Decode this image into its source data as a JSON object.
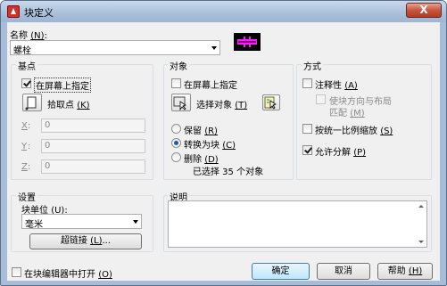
{
  "window": {
    "title": "块定义",
    "close_label": "X"
  },
  "name": {
    "label_text": "名称 ",
    "label_key": "(N)",
    "label_colon": ":",
    "value": "螺栓"
  },
  "base_point": {
    "group_label": "基点",
    "specify_on_screen_text": "在屏幕上指定",
    "pick_point_text": "拾取点 ",
    "pick_point_key": "(K)",
    "x_label": "X",
    "y_label": "Y",
    "z_label": "Z",
    "x_value": "0",
    "y_value": "0",
    "z_value": "0"
  },
  "objects": {
    "group_label": "对象",
    "specify_on_screen_text": "在屏幕上指定",
    "select_objects_text": "选择对象 ",
    "select_objects_key": "(T)",
    "retain_text": "保留 ",
    "retain_key": "(R)",
    "convert_text": "转换为块 ",
    "convert_key": "(C)",
    "delete_text": "删除 ",
    "delete_key": "(D)",
    "selected_status": "已选择 35 个对象"
  },
  "behavior": {
    "group_label": "方式",
    "annotative_text": "注释性 ",
    "annotative_key": "(A)",
    "match_orientation_line1": "使块方向与布局",
    "match_orientation_line2": "匹配 ",
    "match_orientation_key": "(M)",
    "scale_uniformly_text": "按统一比例缩放 ",
    "scale_uniformly_key": "(S)",
    "allow_exploding_text": "允许分解 ",
    "allow_exploding_key": "(P)"
  },
  "settings": {
    "group_label": "设置",
    "block_unit_label": "块单位 ",
    "block_unit_key": "(U)",
    "block_unit_colon": ":",
    "block_unit_value": "毫米",
    "hyperlink_text": "超链接 ",
    "hyperlink_key": "(L)",
    "hyperlink_ellipsis": "..."
  },
  "description": {
    "group_label": "说明",
    "value": ""
  },
  "footer": {
    "open_in_editor_text": "在块编辑器中打开 ",
    "open_in_editor_key": "(O)",
    "ok_label": "确定",
    "cancel_label": "取消",
    "help_text": "帮助 ",
    "help_key": "(H)"
  },
  "colors": {
    "accent": "#3c7fb1",
    "title_bar": "#a9bfda",
    "close": "#c8543c",
    "preview_bg": "#000000",
    "preview_shape": "#ff1aff"
  }
}
